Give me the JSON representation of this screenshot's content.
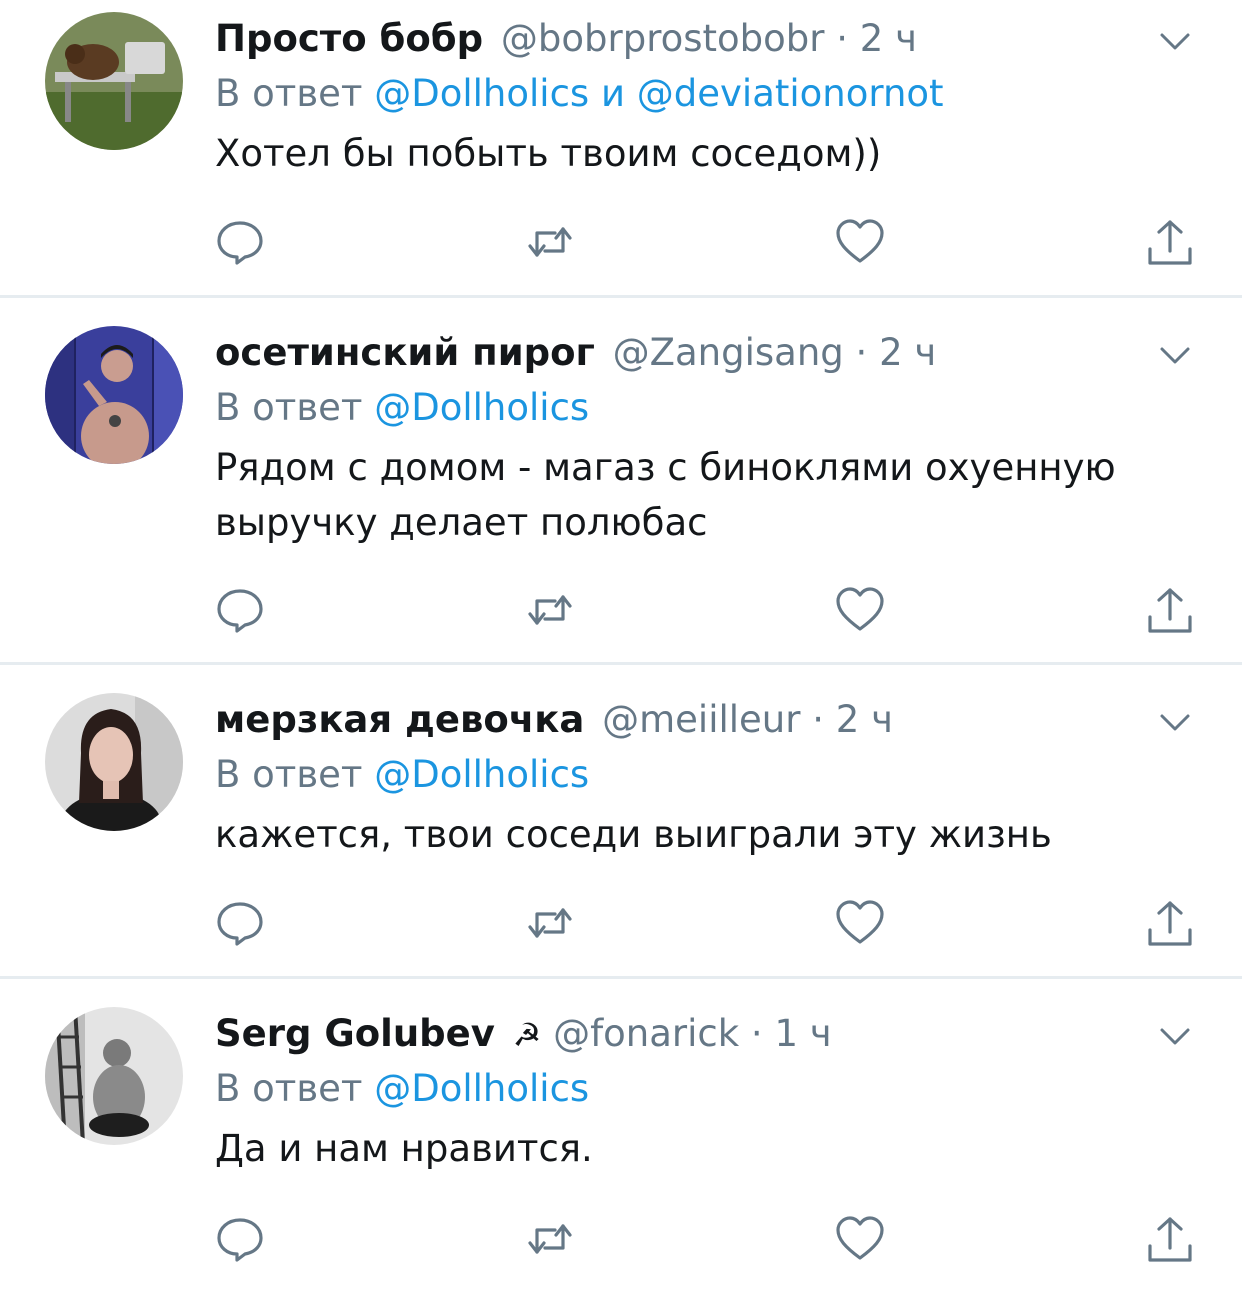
{
  "tweets": [
    {
      "name": "Просто бобр",
      "handle": "@bobrprostobobr",
      "dot": "·",
      "time": "2 ч",
      "flag": "",
      "reply_prefix": "В ответ",
      "mentions": [
        "@Dollholics",
        "@deviationornot"
      ],
      "mention_joiner": "и",
      "text": "Хотел бы побыть твоим соседом))",
      "avatar": "beaver-laptop-avatar"
    },
    {
      "name": "осетинский пирог",
      "handle": "@Zangisang",
      "dot": "·",
      "time": "2 ч",
      "flag": "",
      "reply_prefix": "В ответ",
      "mentions": [
        "@Dollholics"
      ],
      "text": "Рядом с домом - магаз с биноклями охуенную выручку делает полюбас",
      "avatar": "tattooed-man-avatar"
    },
    {
      "name": "мерзкая девочка",
      "handle": "@meiilleur",
      "dot": "·",
      "time": "2 ч",
      "flag": "",
      "reply_prefix": "В ответ",
      "mentions": [
        "@Dollholics"
      ],
      "text": "кажется, твои соседи выиграли эту жизнь",
      "avatar": "girl-portrait-avatar"
    },
    {
      "name": "Serg Golubev",
      "handle": "@fonarick",
      "dot": "·",
      "time": "1 ч",
      "flag": "☭",
      "reply_prefix": "В ответ",
      "mentions": [
        "@Dollholics"
      ],
      "text": "Да и нам нравится.",
      "avatar": "bw-man-hat-avatar"
    }
  ],
  "colors": {
    "name": "#14171a",
    "secondary": "#657786",
    "link": "#1b95e0",
    "icon": "#657786",
    "divider": "#e6ecf0"
  },
  "icons": {
    "reply": "reply-icon",
    "retweet": "retweet-icon",
    "like": "like-icon",
    "share": "share-icon",
    "menu": "chevron-down-icon"
  }
}
